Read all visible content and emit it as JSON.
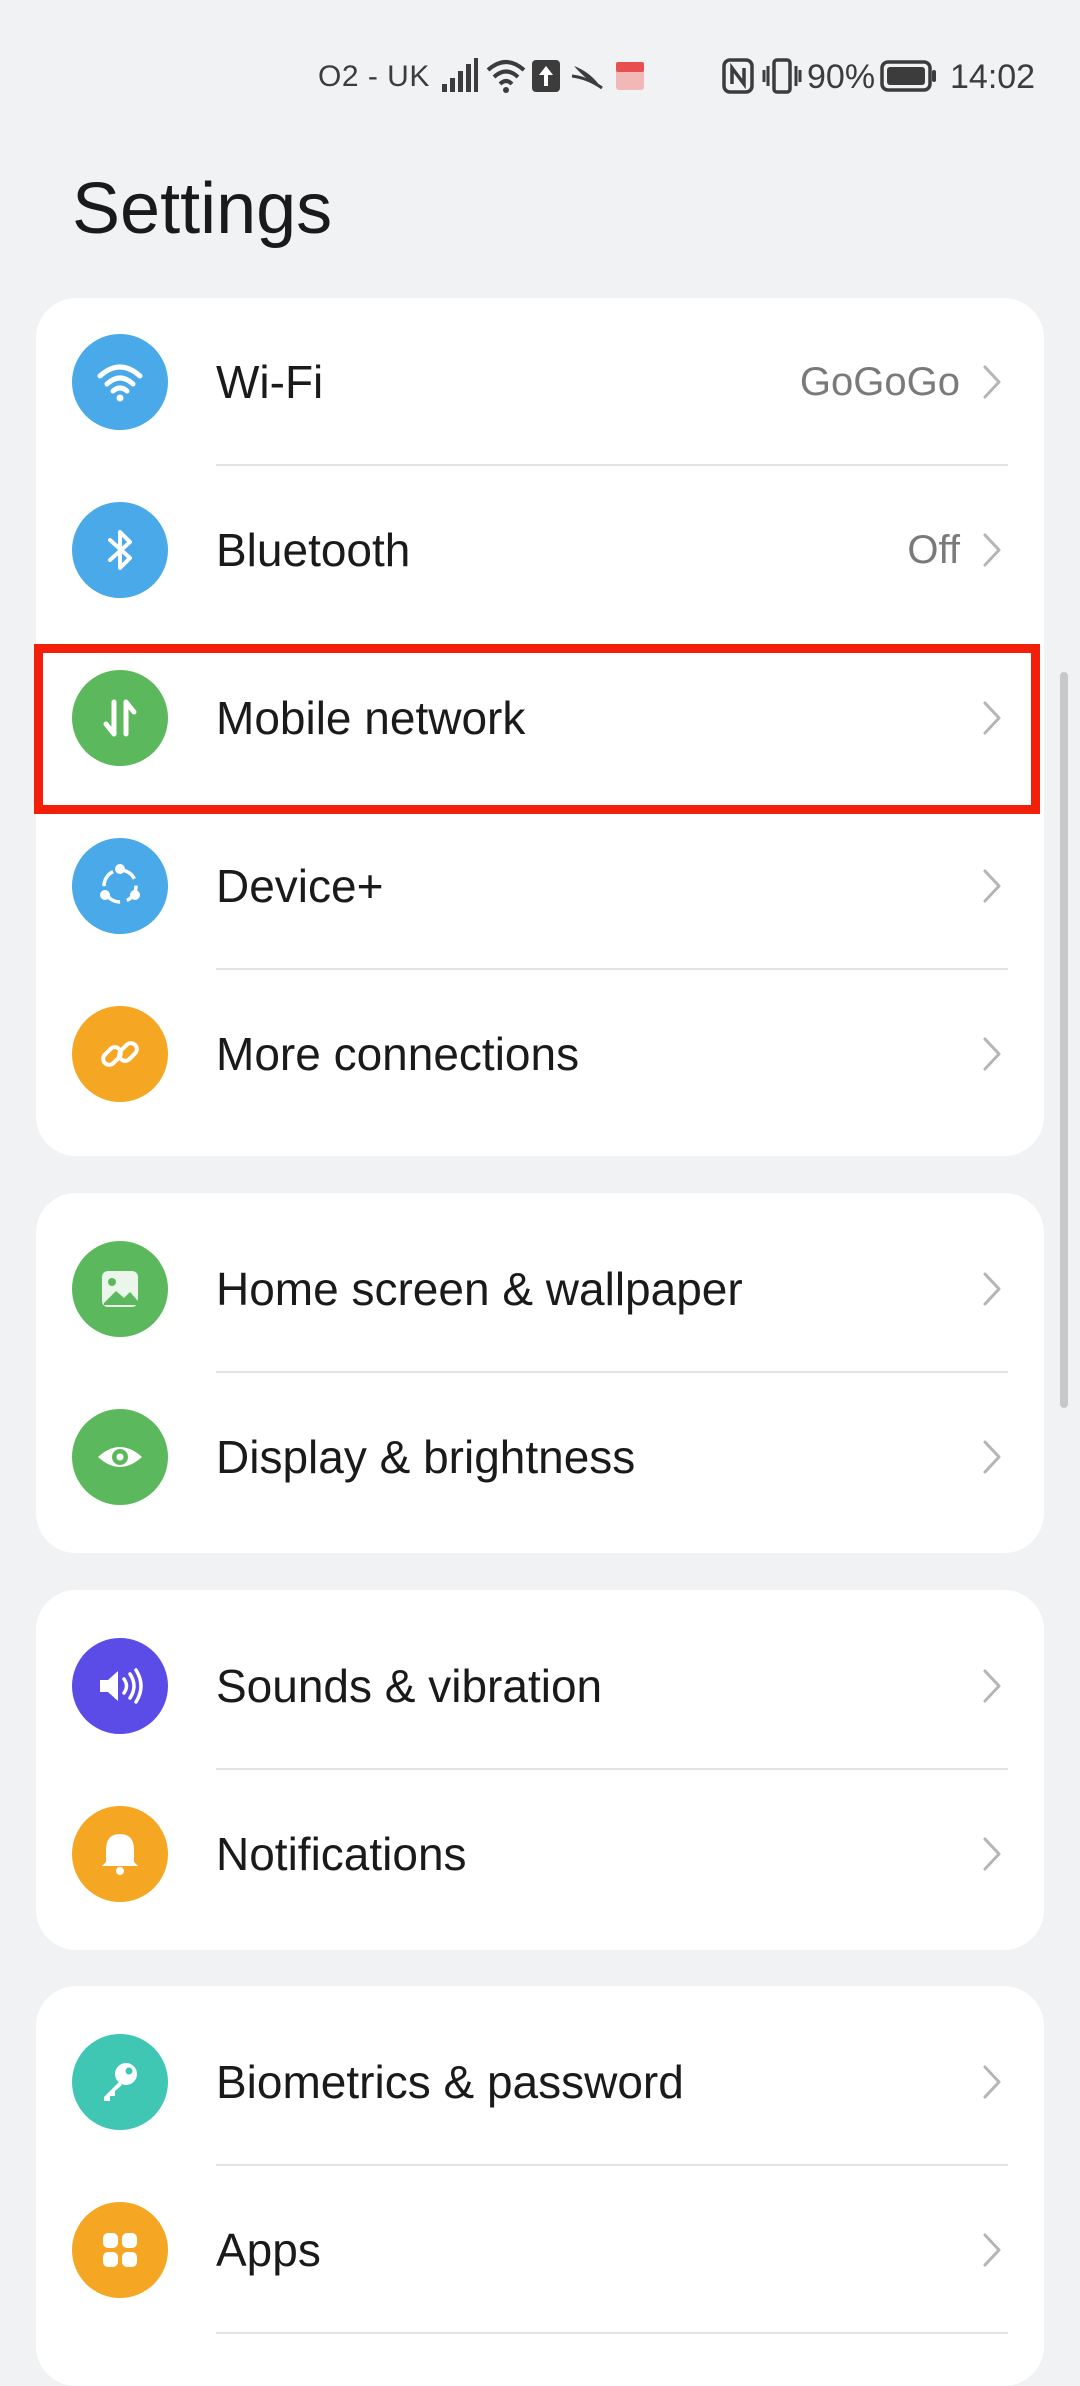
{
  "status_bar": {
    "carrier": "O2 - UK",
    "battery": "90%",
    "time": "14:02"
  },
  "page_title": "Settings",
  "groups": [
    {
      "items": [
        {
          "label": "Wi-Fi",
          "value": "GoGoGo",
          "icon": "wifi-icon",
          "color": "#4aa9e8"
        },
        {
          "label": "Bluetooth",
          "value": "Off",
          "icon": "bluetooth-icon",
          "color": "#4aa9e8"
        },
        {
          "label": "Mobile network",
          "value": "",
          "icon": "mobile-data-icon",
          "color": "#5cb85c"
        },
        {
          "label": "Device+",
          "value": "",
          "icon": "device-plus-icon",
          "color": "#4aa9e8"
        },
        {
          "label": "More connections",
          "value": "",
          "icon": "link-icon",
          "color": "#f5a623"
        }
      ]
    },
    {
      "items": [
        {
          "label": "Home screen & wallpaper",
          "value": "",
          "icon": "wallpaper-icon",
          "color": "#5cb85c"
        },
        {
          "label": "Display & brightness",
          "value": "",
          "icon": "eye-icon",
          "color": "#5cb85c"
        }
      ]
    },
    {
      "items": [
        {
          "label": "Sounds & vibration",
          "value": "",
          "icon": "speaker-icon",
          "color": "#5b4ce8"
        },
        {
          "label": "Notifications",
          "value": "",
          "icon": "bell-icon",
          "color": "#f5a623"
        }
      ]
    },
    {
      "items": [
        {
          "label": "Biometrics & password",
          "value": "",
          "icon": "key-icon",
          "color": "#3fc7b4"
        },
        {
          "label": "Apps",
          "value": "",
          "icon": "apps-grid-icon",
          "color": "#f5a623"
        }
      ]
    }
  ],
  "colors": {
    "highlight": "#f21f0a",
    "background": "#f1f2f4"
  }
}
